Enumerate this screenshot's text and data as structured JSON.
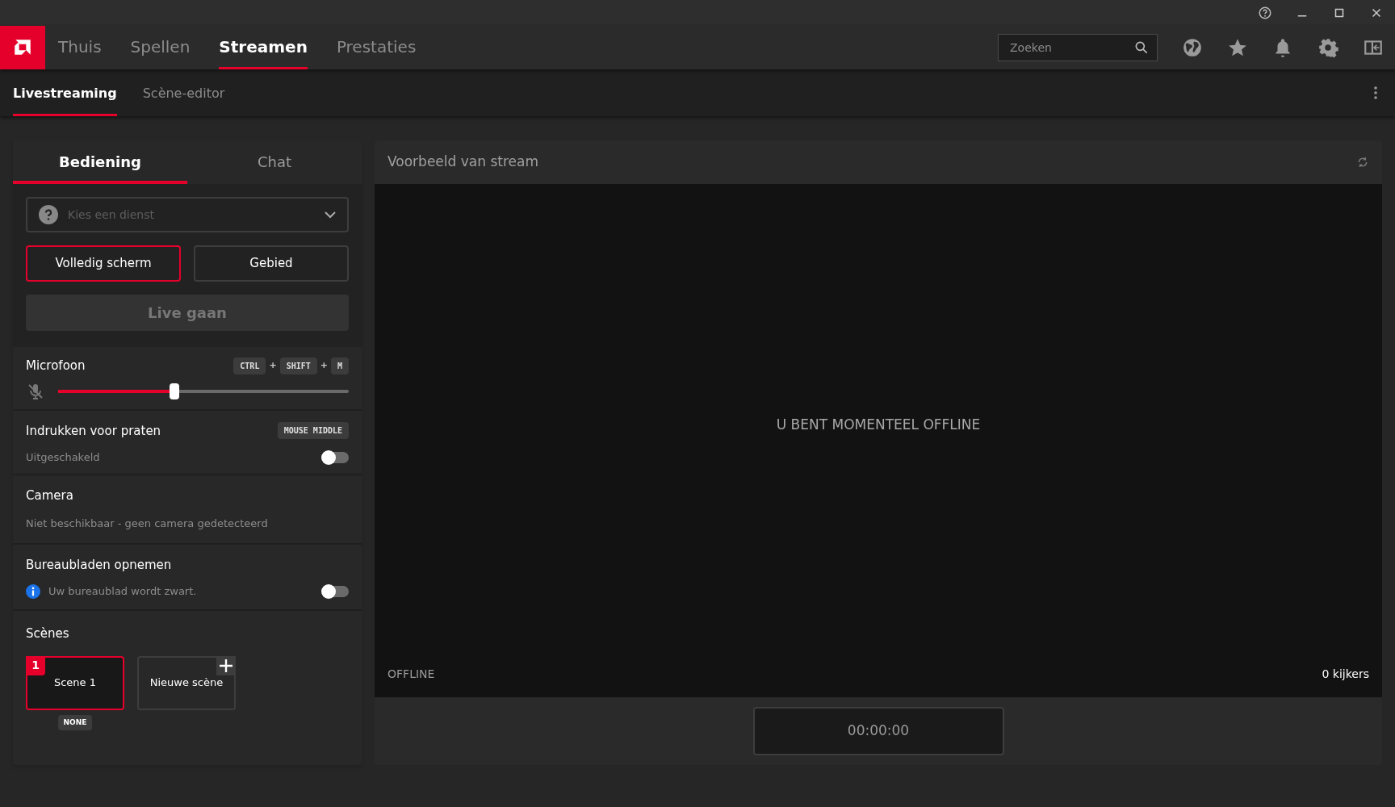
{
  "top_nav": {
    "items": [
      {
        "label": "Thuis",
        "selected": false
      },
      {
        "label": "Spellen",
        "selected": false
      },
      {
        "label": "Streamen",
        "selected": true
      },
      {
        "label": "Prestaties",
        "selected": false
      }
    ],
    "search": {
      "placeholder": "Zoeken"
    }
  },
  "sub_nav": [
    {
      "label": "Livestreaming",
      "selected": true
    },
    {
      "label": "Scène-editor",
      "selected": false
    }
  ],
  "panel_tabs": [
    {
      "label": "Bediening",
      "selected": true
    },
    {
      "label": "Chat",
      "selected": false
    }
  ],
  "service": {
    "placeholder": "Kies een dienst"
  },
  "capture_modes": [
    {
      "label": "Volledig scherm",
      "selected": true
    },
    {
      "label": "Gebied",
      "selected": false
    }
  ],
  "go_live": {
    "label": "Live gaan",
    "disabled": true
  },
  "microphone": {
    "title": "Microfoon",
    "shortcut": [
      "CTRL",
      "SHIFT",
      "M"
    ],
    "separator": "+",
    "muted": true,
    "level": 0.4
  },
  "push_to_talk": {
    "title": "Indrukken voor praten",
    "shortcut": "MOUSE MIDDLE",
    "status": "Uitgeschakeld",
    "on": false
  },
  "camera": {
    "title": "Camera",
    "status": "Niet beschikbaar - geen camera gedetecteerd"
  },
  "desktop_capture": {
    "title": "Bureaubladen opnemen",
    "info": "Uw bureaublad wordt zwart.",
    "on": false
  },
  "scenes": {
    "title": "Scènes",
    "items": [
      {
        "number": "1",
        "label": "Scene 1",
        "tag": "NONE",
        "selected": true
      }
    ],
    "new_label": "Nieuwe scène"
  },
  "preview": {
    "title": "Voorbeeld van stream",
    "message": "U BENT MOMENTEEL OFFLINE",
    "status": "OFFLINE",
    "viewers": "0 kijkers",
    "timer": "00:00:00"
  }
}
